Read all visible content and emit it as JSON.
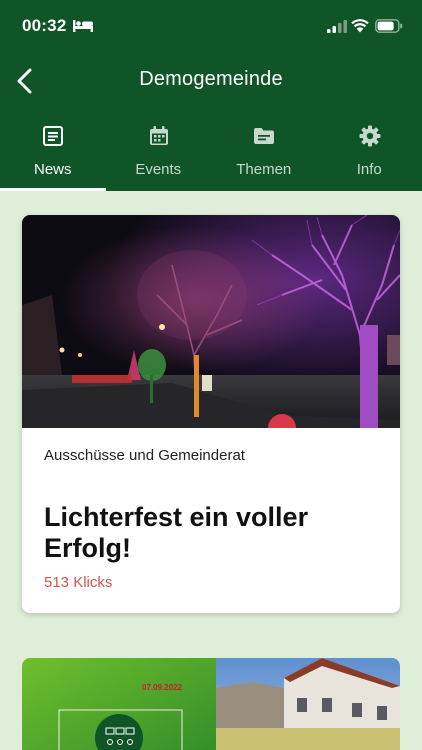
{
  "status_bar": {
    "time": "00:32"
  },
  "header": {
    "title": "Demogemeinde"
  },
  "tabs": [
    {
      "label": "News",
      "icon": "news-icon",
      "active": true
    },
    {
      "label": "Events",
      "icon": "calendar-icon",
      "active": false
    },
    {
      "label": "Themen",
      "icon": "folder-icon",
      "active": false
    },
    {
      "label": "Info",
      "icon": "gear-icon",
      "active": false
    }
  ],
  "news": [
    {
      "category": "Ausschüsse und Gemeinderat",
      "title": "Lichterfest ein voller Erfolg!",
      "clicks": "513 Klicks"
    },
    {
      "date": "07.09.2022"
    }
  ],
  "colors": {
    "header": "#0f5527",
    "background": "#dfeed8",
    "clicks": "#d9534f",
    "accent": "#ffffff"
  }
}
